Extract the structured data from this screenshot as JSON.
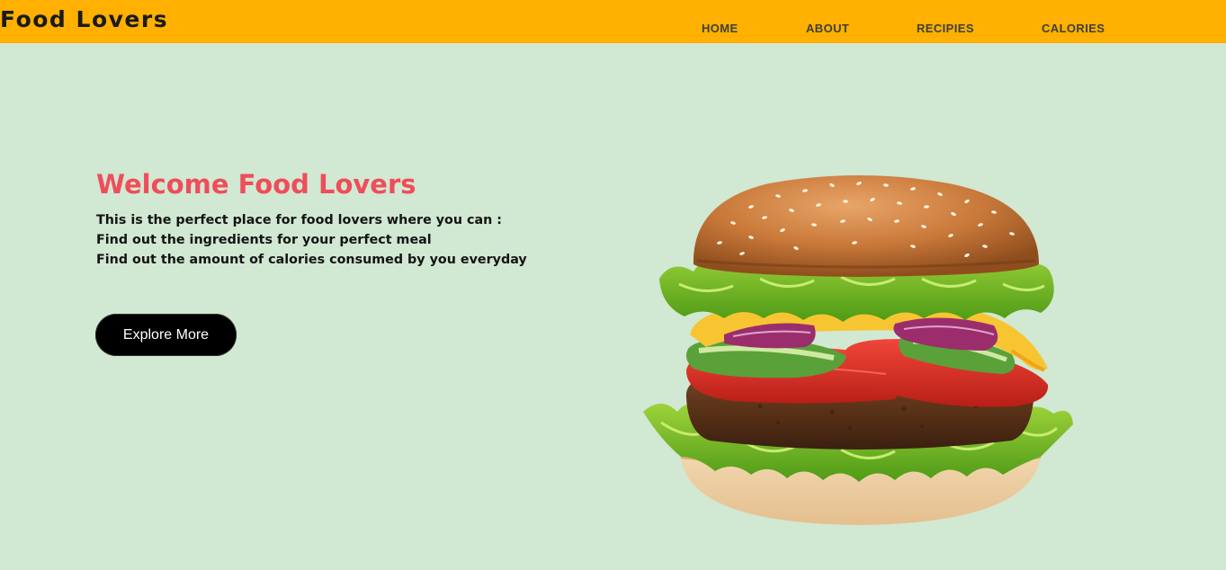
{
  "header": {
    "brand": "Food Lovers",
    "nav": [
      {
        "label": "HOME"
      },
      {
        "label": "ABOUT"
      },
      {
        "label": "RECIPIES"
      },
      {
        "label": "CALORIES"
      }
    ]
  },
  "hero": {
    "title": "Welcome Food Lovers",
    "lines": [
      "This is the perfect place for food lovers where you can :",
      "Find out the ingredients for your perfect meal",
      "Find out the amount of calories consumed by you everyday"
    ],
    "cta_label": "Explore More"
  },
  "colors": {
    "navbar": "#ffb000",
    "background": "#d1e8d2",
    "title": "#ef4d5a",
    "button": "#000000"
  },
  "icons": {
    "hero_image": "burger-image"
  }
}
